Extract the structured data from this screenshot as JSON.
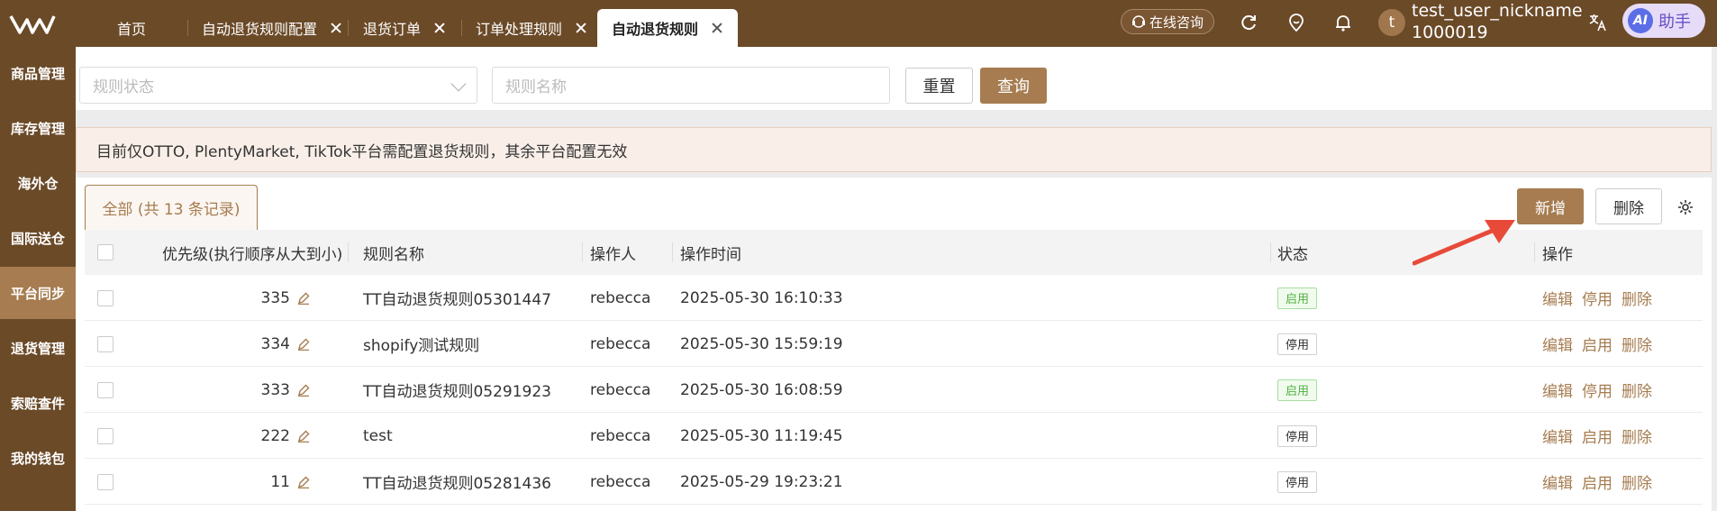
{
  "topbar": {
    "tabs": [
      {
        "label": "首页",
        "closable": false,
        "active": false
      },
      {
        "label": "自动退货规则配置",
        "closable": true,
        "active": false
      },
      {
        "label": "退货订单",
        "closable": true,
        "active": false
      },
      {
        "label": "订单处理规则",
        "closable": true,
        "active": false
      },
      {
        "label": "自动退货规则",
        "closable": true,
        "active": true
      }
    ],
    "consult_label": "在线咨询",
    "user_initial": "t",
    "username": "test_user_nickname",
    "user_id": "1000019",
    "ai_badge": "AI",
    "ai_label": "助手"
  },
  "sidebar": {
    "items": [
      {
        "label": "商品管理",
        "active": false
      },
      {
        "label": "库存管理",
        "active": false
      },
      {
        "label": "海外仓",
        "active": false
      },
      {
        "label": "国际送仓",
        "active": false
      },
      {
        "label": "平台同步",
        "active": true
      },
      {
        "label": "退货管理",
        "active": false
      },
      {
        "label": "索赔查件",
        "active": false
      },
      {
        "label": "我的钱包",
        "active": false
      }
    ]
  },
  "filters": {
    "status_placeholder": "规则状态",
    "name_placeholder": "规则名称",
    "reset_label": "重置",
    "query_label": "查询"
  },
  "notice": "目前仅OTTO, PlentyMarket, TikTok平台需配置退货规则，其余平台配置无效",
  "panel": {
    "count_tab": "全部 (共 13 条记录)",
    "add_label": "新增",
    "delete_label": "删除"
  },
  "table": {
    "headers": {
      "priority": "优先级(执行顺序从大到小)",
      "name": "规则名称",
      "operator": "操作人",
      "time": "操作时间",
      "status": "状态",
      "actions": "操作"
    },
    "rows": [
      {
        "priority": "335",
        "name": "TT自动退货规则05301447",
        "operator": "rebecca",
        "time": "2025-05-30 16:10:33",
        "status": "启用",
        "enabled": true,
        "actions": [
          "编辑",
          "停用",
          "删除"
        ]
      },
      {
        "priority": "334",
        "name": "shopify测试规则",
        "operator": "rebecca",
        "time": "2025-05-30 15:59:19",
        "status": "停用",
        "enabled": false,
        "actions": [
          "编辑",
          "启用",
          "删除"
        ]
      },
      {
        "priority": "333",
        "name": "TT自动退货规则05291923",
        "operator": "rebecca",
        "time": "2025-05-30 16:08:59",
        "status": "启用",
        "enabled": true,
        "actions": [
          "编辑",
          "停用",
          "删除"
        ]
      },
      {
        "priority": "222",
        "name": "test",
        "operator": "rebecca",
        "time": "2025-05-30 11:19:45",
        "status": "停用",
        "enabled": false,
        "actions": [
          "编辑",
          "启用",
          "删除"
        ]
      },
      {
        "priority": "11",
        "name": "TT自动退货规则05281436",
        "operator": "rebecca",
        "time": "2025-05-29 19:23:21",
        "status": "停用",
        "enabled": false,
        "actions": [
          "编辑",
          "启用",
          "删除"
        ]
      }
    ]
  },
  "colors": {
    "brand": "#6b4a28",
    "accent": "#a67c50",
    "enabled": "#52b041",
    "annotation_arrow": "#e84a3a"
  }
}
